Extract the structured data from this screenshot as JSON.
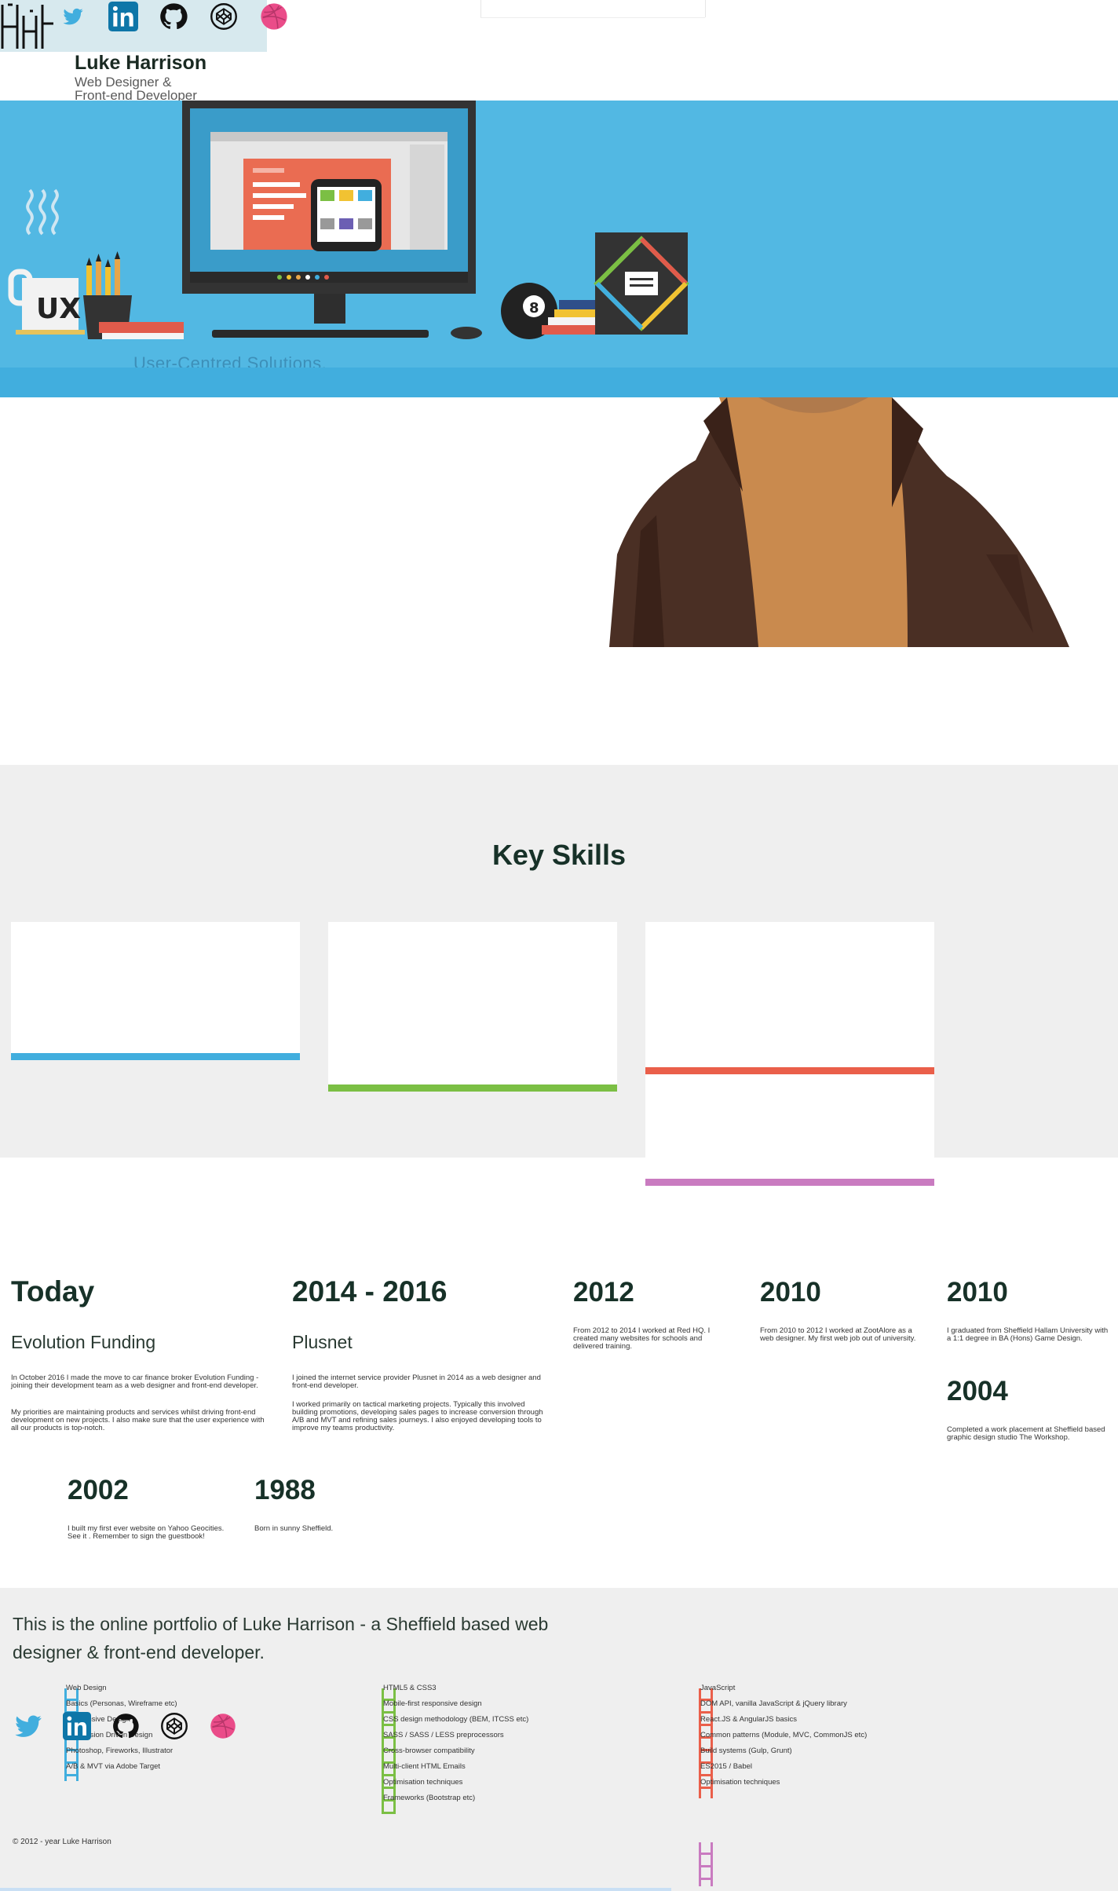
{
  "header": {
    "name": "Luke Harrison",
    "role_line1": "Web Designer &",
    "role_line2": "Front-end Developer",
    "social": [
      "twitter-icon",
      "linkedin-icon",
      "github-icon",
      "codepen-icon",
      "dribbble-icon"
    ]
  },
  "hero": {
    "mug_label": "UX",
    "ball_number": "8",
    "ghost_text": "User-Centred Solutions."
  },
  "skills": {
    "title": "Key Skills",
    "bar_colors": [
      "#41aede",
      "#7bbf44",
      "#ea5f4a",
      "#c97bc0"
    ]
  },
  "timeline": [
    {
      "year": "Today",
      "title": "Evolution Funding",
      "paragraphs": [
        "In October 2016 I made the move to car finance broker Evolution Funding - joining their development team as a web designer and front-end developer.",
        "My priorities are maintaining products and services whilst driving front-end development on new projects. I also make sure that the user experience with all our products is top-notch."
      ]
    },
    {
      "year": "2014 - 2016",
      "title": "Plusnet",
      "paragraphs": [
        "I joined the internet service provider Plusnet in 2014 as a web designer and front-end developer.",
        "I worked primarily on tactical marketing projects. Typically this involved building promotions, developing sales pages to increase conversion through A/B and MVT and refining sales journeys. I also enjoyed developing tools to improve my teams productivity."
      ]
    },
    {
      "year": "2012",
      "paragraphs": [
        "From 2012 to 2014 I worked at Red HQ. I created many websites for schools and delivered training."
      ]
    },
    {
      "year": "2010",
      "paragraphs": [
        "From 2010 to 2012 I worked at ZootAlore as a web designer. My first web job out of university."
      ]
    },
    {
      "year": "2010",
      "paragraphs": [
        "I graduated from Sheffield Hallam University with a 1:1 degree in BA (Hons) Game Design."
      ]
    },
    {
      "year": "2004",
      "paragraphs": [
        "Completed a work placement at Sheffield based graphic design studio The Workshop."
      ]
    },
    {
      "year": "2002",
      "paragraphs": [
        "I built my first ever website on Yahoo Geocities. See it         . Remember to sign the guestbook!"
      ]
    },
    {
      "year": "1988",
      "paragraphs": [
        "Born in sunny Sheffield."
      ]
    }
  ],
  "footer": {
    "intro": "This is the online portfolio of Luke Harrison - a Sheffield based web designer & front-end developer.",
    "design_skills": [
      "Web Design",
      "Basics (Personas, Wireframe etc)",
      "Responsive Design",
      "Conversion Driven Design",
      "Photoshop, Fireworks, Illustrator",
      "A/B & MVT via Adobe Target"
    ],
    "frontend_skills": [
      "HTML5 & CSS3",
      "Mobile-first responsive design",
      "CSS design methodology (BEM, ITCSS etc)",
      "SASS / SASS / LESS preprocessors",
      "Cross-browser compatibility",
      "Multi-client HTML Emails",
      "Optimisation techniques",
      "Frameworks (Bootstrap etc)"
    ],
    "js_skills": [
      "JavaScript",
      "DOM API, vanilla JavaScript & jQuery library",
      "React.JS & AngularJS basics",
      "Common patterns (Module, MVC, CommonJS etc)",
      "Build systems (Gulp, Grunt)",
      "ES2015 / Babel",
      "Optimisation techniques"
    ],
    "social": [
      "twitter-icon",
      "linkedin-icon",
      "github-icon",
      "codepen-icon",
      "dribbble-icon"
    ],
    "copyright": "© 2012 - year Luke Harrison"
  }
}
